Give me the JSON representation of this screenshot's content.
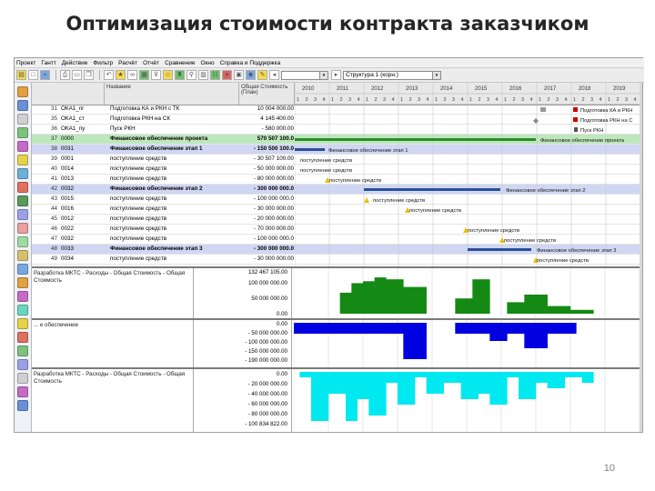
{
  "slide": {
    "title": "Оптимизация стоимости контракта заказчиком",
    "page_number": "10"
  },
  "menu": [
    "Проект",
    "Гантт",
    "Действие",
    "Фильтр",
    "Расчёт",
    "Отчёт",
    "Сравнение",
    "Окно",
    "Справка и Поддержка"
  ],
  "toolbar": {
    "structure_select": "Структура 1 (корн.)"
  },
  "grid": {
    "headers": {
      "name": "Название",
      "cost": "Общая Стоимость (План)"
    },
    "rows": [
      {
        "num": "31",
        "code": "ОКА1_пг",
        "name": "Подготовка КА и РКН с ТК",
        "cost": "10 004 000.00",
        "style": ""
      },
      {
        "num": "35",
        "code": "ОКА1_ст",
        "name": "Подготовка РКН на СК",
        "cost": "4 145 400.00",
        "style": ""
      },
      {
        "num": "36",
        "code": "ОКА1_пу",
        "name": "Пуск РКН",
        "cost": "- 580 000.00",
        "style": ""
      },
      {
        "num": "37",
        "code": "0000",
        "name": "Финансовое обеспечение проекта",
        "cost": "570 507 100.0",
        "style": "green"
      },
      {
        "num": "38",
        "code": "0031",
        "name": "Финансовое обеспечение этап 1",
        "cost": "- 150 500 100.0",
        "style": "blue"
      },
      {
        "num": "39",
        "code": "0001",
        "name": "поступление средств",
        "cost": "- 30 507 100.00",
        "style": ""
      },
      {
        "num": "40",
        "code": "0014",
        "name": "поступление средств",
        "cost": "- 50 000 000.00",
        "style": ""
      },
      {
        "num": "41",
        "code": "0013",
        "name": "поступление средств",
        "cost": "- 80 000 000.00",
        "style": ""
      },
      {
        "num": "42",
        "code": "0032",
        "name": "Финансовое обеспечение этап 2",
        "cost": "- 300 000 000.0",
        "style": "blue"
      },
      {
        "num": "43",
        "code": "0015",
        "name": "поступление средств",
        "cost": "- 100 000 000.0",
        "style": ""
      },
      {
        "num": "44",
        "code": "0016",
        "name": "поступление средств",
        "cost": "- 30 000 000.00",
        "style": ""
      },
      {
        "num": "45",
        "code": "0012",
        "name": "поступление средств",
        "cost": "- 20 000 000.00",
        "style": ""
      },
      {
        "num": "46",
        "code": "0022",
        "name": "поступление средств",
        "cost": "- 70 000 000.00",
        "style": ""
      },
      {
        "num": "47",
        "code": "0032",
        "name": "поступление средств",
        "cost": "- 100 000 000.0",
        "style": ""
      },
      {
        "num": "48",
        "code": "0033",
        "name": "Финансовое обеспечение этап 3",
        "cost": "- 300 000 000.0",
        "style": "blue"
      },
      {
        "num": "49",
        "code": "0034",
        "name": "поступление средств",
        "cost": "- 30 000 000.00",
        "style": ""
      }
    ]
  },
  "gantt": {
    "years": [
      "2010",
      "2011",
      "2012",
      "2013",
      "2014",
      "2015",
      "2016",
      "2017",
      "2018",
      "2019"
    ],
    "quarter_labels": [
      "1",
      "2",
      "3",
      "4"
    ],
    "labels": [
      "Подготовка КА и РКН",
      "Подготовка РКН на С",
      "Пуск РКН",
      "Финансовое обеспечение проекта",
      "Финансовое обеспечение этап 1",
      "поступление средств",
      "поступление средств",
      "Финансовое обеспечение этап 2",
      "поступление средств",
      "поступление средств",
      "поступление средств",
      "Финансовое обеспечение этап 3",
      "поступление средств"
    ],
    "colors": {
      "summary": "#2a4f9a",
      "project": "#2b8a2b",
      "milestone": "#e8c000",
      "accent_red": "#d00000"
    }
  },
  "panes": [
    {
      "label": "Разработка МКТС - Расходы - Общая Стоимость - Общая Стоимость",
      "ticks": [
        "132 467 105.00",
        "100 000 000.00",
        "50 000 000.00",
        "0.00"
      ],
      "color": "#148a14"
    },
    {
      "label": "... е обеспечение",
      "ticks": [
        "0.00",
        "- 50 000 000.00",
        "- 100 000 000.00",
        "- 150 000 000.00",
        "- 190 000 000.00"
      ],
      "color": "#0000e0"
    },
    {
      "label": "Разработка МКТС - Расходы - Общая Стоимость - Общая Стоимость",
      "ticks": [
        "0.00",
        "- 20 000 000.00",
        "- 40 000 000.00",
        "- 60 000 000.00",
        "- 80 000 000.00",
        "- 100 834 822.00"
      ],
      "color": "#00e8f0"
    }
  ],
  "pane_series": {
    "green": [
      0,
      0,
      0,
      0,
      0,
      0,
      0,
      0,
      55,
      55,
      80,
      80,
      85,
      85,
      95,
      95,
      90,
      90,
      90,
      70,
      70,
      70,
      70,
      0,
      0,
      0,
      0,
      0,
      40,
      40,
      40,
      90,
      90,
      90,
      0,
      0,
      0,
      30,
      30,
      30,
      50,
      50,
      50,
      50,
      20,
      20,
      20,
      20,
      10,
      10,
      10,
      10,
      0,
      0,
      0,
      0,
      0,
      0,
      0,
      0
    ],
    "blue": [
      30,
      30,
      30,
      30,
      30,
      30,
      30,
      30,
      30,
      30,
      30,
      30,
      30,
      30,
      30,
      30,
      30,
      30,
      30,
      100,
      100,
      100,
      100,
      0,
      0,
      0,
      0,
      0,
      30,
      30,
      30,
      30,
      30,
      30,
      50,
      50,
      50,
      30,
      30,
      30,
      70,
      70,
      70,
      70,
      30,
      30,
      30,
      30,
      30,
      0,
      0,
      0,
      0,
      0,
      0,
      0,
      0,
      0,
      0,
      0
    ],
    "cyan": [
      0,
      10,
      10,
      90,
      90,
      90,
      40,
      40,
      40,
      90,
      90,
      50,
      50,
      80,
      80,
      80,
      20,
      20,
      60,
      60,
      60,
      10,
      10,
      40,
      40,
      40,
      20,
      20,
      20,
      50,
      50,
      50,
      40,
      40,
      60,
      60,
      60,
      10,
      10,
      50,
      50,
      50,
      20,
      20,
      30,
      30,
      30,
      10,
      10,
      10,
      20,
      20,
      0,
      0,
      0,
      0,
      0,
      0,
      0,
      0
    ]
  }
}
